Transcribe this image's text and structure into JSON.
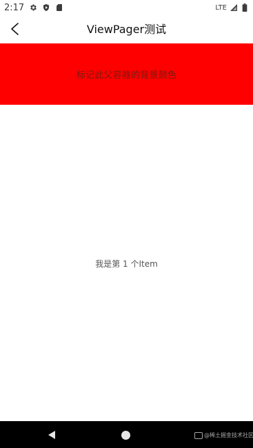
{
  "status_bar": {
    "time": "2:17",
    "network": "LTE",
    "icons": [
      "settings-icon",
      "shield-play-icon",
      "sd-card-icon",
      "signal-icon",
      "battery-icon"
    ]
  },
  "toolbar": {
    "title": "ViewPager测试",
    "back_icon": "chevron-left-icon"
  },
  "header": {
    "text": "标记此父容器的背景颜色",
    "background_color": "#ff0000"
  },
  "pager": {
    "item_text": "我是第 1 个Item"
  },
  "nav_bar": {
    "back_icon": "triangle-back-icon",
    "home_icon": "circle-home-icon",
    "watermark": "@稀土掘金技术社区"
  }
}
